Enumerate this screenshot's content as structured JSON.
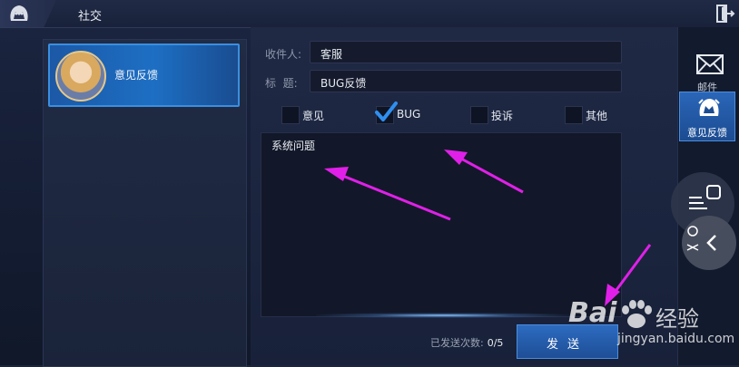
{
  "header": {
    "title": "社交"
  },
  "contacts": [
    {
      "name": "意见反馈"
    }
  ],
  "form": {
    "recipient_label": "收件人:",
    "recipient_value": "客服",
    "subject_label": "标  题:",
    "subject_value": "BUG反馈",
    "options": [
      {
        "label": "意见",
        "checked": false
      },
      {
        "label": "BUG",
        "checked": true
      },
      {
        "label": "投诉",
        "checked": false
      },
      {
        "label": "其他",
        "checked": false
      }
    ],
    "message": "系统问题",
    "send_count_label": "已发送次数:",
    "send_count_value": "0/5",
    "send_button": "发送"
  },
  "side_tabs": [
    {
      "label": "邮件",
      "icon": "mail-icon",
      "active": false
    },
    {
      "label": "意见反馈",
      "icon": "feedback-icon",
      "active": true
    }
  ],
  "watermark": {
    "brand": "Bai",
    "brand2": "经验",
    "url": "jingyan.baidu.com"
  },
  "colors": {
    "accent": "#1d6fc4",
    "annotation_arrow": "#e020e8",
    "check": "#2f8ff0"
  }
}
